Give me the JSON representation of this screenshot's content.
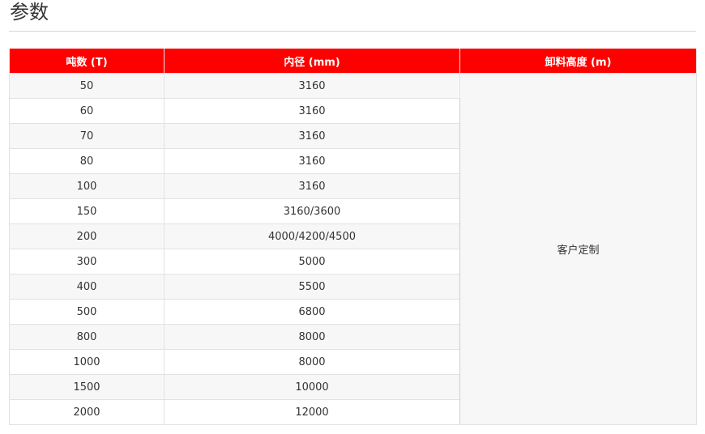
{
  "heading": "参数",
  "table": {
    "headers": [
      "吨数 (T)",
      "内径 (mm)",
      "卸料高度 (m)"
    ],
    "rows": [
      {
        "tonnage": "50",
        "inner_diameter": "3160"
      },
      {
        "tonnage": "60",
        "inner_diameter": "3160"
      },
      {
        "tonnage": "70",
        "inner_diameter": "3160"
      },
      {
        "tonnage": "80",
        "inner_diameter": "3160"
      },
      {
        "tonnage": "100",
        "inner_diameter": "3160"
      },
      {
        "tonnage": "150",
        "inner_diameter": "3160/3600"
      },
      {
        "tonnage": "200",
        "inner_diameter": "4000/4200/4500"
      },
      {
        "tonnage": "300",
        "inner_diameter": "5000"
      },
      {
        "tonnage": "400",
        "inner_diameter": "5500"
      },
      {
        "tonnage": "500",
        "inner_diameter": "6800"
      },
      {
        "tonnage": "800",
        "inner_diameter": "8000"
      },
      {
        "tonnage": "1000",
        "inner_diameter": "8000"
      },
      {
        "tonnage": "1500",
        "inner_diameter": "10000"
      },
      {
        "tonnage": "2000",
        "inner_diameter": "12000"
      }
    ],
    "discharge_height": "客户定制"
  },
  "colors": {
    "header_bg": "#ff0000",
    "header_text": "#ffffff",
    "row_alt_bg": "#f7f7f7"
  }
}
